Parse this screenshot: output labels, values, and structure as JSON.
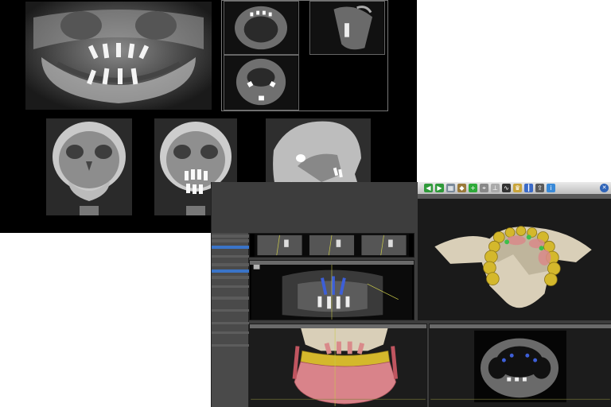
{
  "radiographs": {
    "views": [
      {
        "name": "panoramic",
        "kind": "xray"
      },
      {
        "name": "mpr-axial",
        "kind": "ct-slice"
      },
      {
        "name": "mpr-sagittal",
        "kind": "ct-slice"
      },
      {
        "name": "mpr-coronal",
        "kind": "ct-slice"
      },
      {
        "name": "pa-skull-preop",
        "kind": "xray"
      },
      {
        "name": "pa-skull-postop",
        "kind": "xray"
      },
      {
        "name": "lateral-ceph",
        "kind": "xray"
      }
    ]
  },
  "software": {
    "toolbar": {
      "icons": [
        "back-icon",
        "forward-icon",
        "layout-icon",
        "cube-icon",
        "add-icon",
        "measure-icon",
        "implant-icon",
        "nerve-icon",
        "crown-icon",
        "ruler-icon",
        "export-icon",
        "info-icon"
      ],
      "close_icon": "close-icon"
    },
    "colors": {
      "panel": "#3d3d3d",
      "selection": "#3a74c8",
      "implant_marker": "#3d5fd8",
      "teeth": "#d4b82c",
      "gum": "#d98a8a",
      "bone": "#d9cfb8"
    }
  }
}
